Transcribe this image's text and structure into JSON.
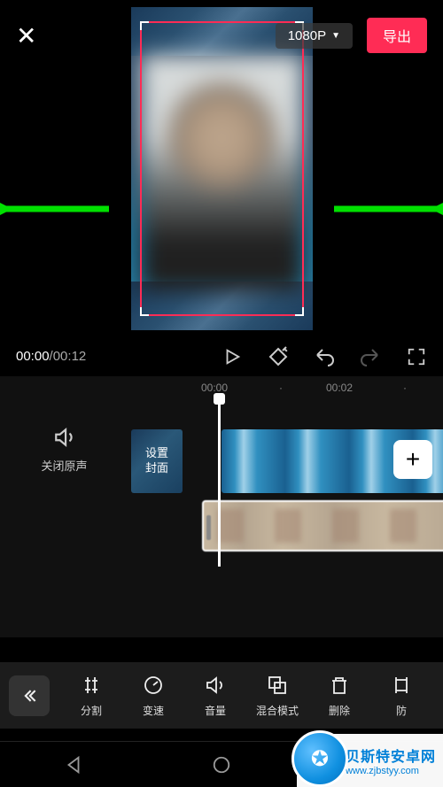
{
  "header": {
    "resolution": "1080P",
    "export_label": "导出"
  },
  "playback": {
    "current_time": "00:00",
    "total_time": "00:12"
  },
  "ruler": {
    "t0": "00:00",
    "t1": "00:02"
  },
  "timeline": {
    "mute_label": "关闭原声",
    "cover_label": "设置\n封面"
  },
  "tools": {
    "split": "分割",
    "speed": "变速",
    "volume": "音量",
    "blend": "混合模式",
    "delete": "删除",
    "prevent": "防"
  },
  "watermark": {
    "title": "贝斯特安卓网",
    "url": "www.zjbstyy.com"
  }
}
